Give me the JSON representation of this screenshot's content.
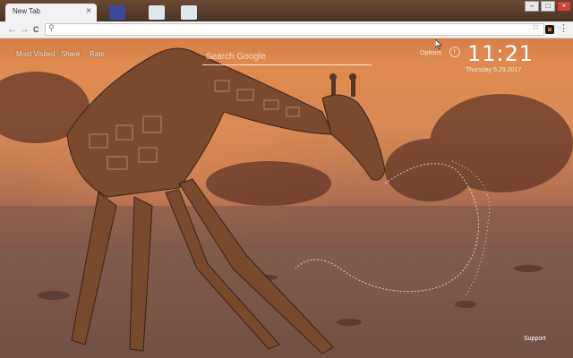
{
  "window": {
    "tab_title": "New Tab",
    "tab_close": "×",
    "controls": {
      "minimize": "–",
      "restore": "□",
      "close": "×"
    }
  },
  "toolbar": {
    "back": "←",
    "forward": "→",
    "reload": "C",
    "search_glyph": "⚲",
    "star": "☆",
    "menu": "⋮",
    "address_value": ""
  },
  "newtab": {
    "links": {
      "most_visited": "Most Visited",
      "share": "Share",
      "rate": "Rate"
    },
    "search": {
      "placeholder": "Search Google"
    },
    "options": "Options",
    "clock": {
      "time": "11:21",
      "date": "Thursday  6.29.2017"
    },
    "support": "Support"
  },
  "icons": {
    "tab_close": "close-icon",
    "alarm": "alarm-clock-icon",
    "extension": "extension-icon",
    "menu": "kebab-menu-icon"
  },
  "colors": {
    "sky": "#e08a50",
    "ground": "#6a4a40",
    "chrome": "#f2f2f2"
  }
}
